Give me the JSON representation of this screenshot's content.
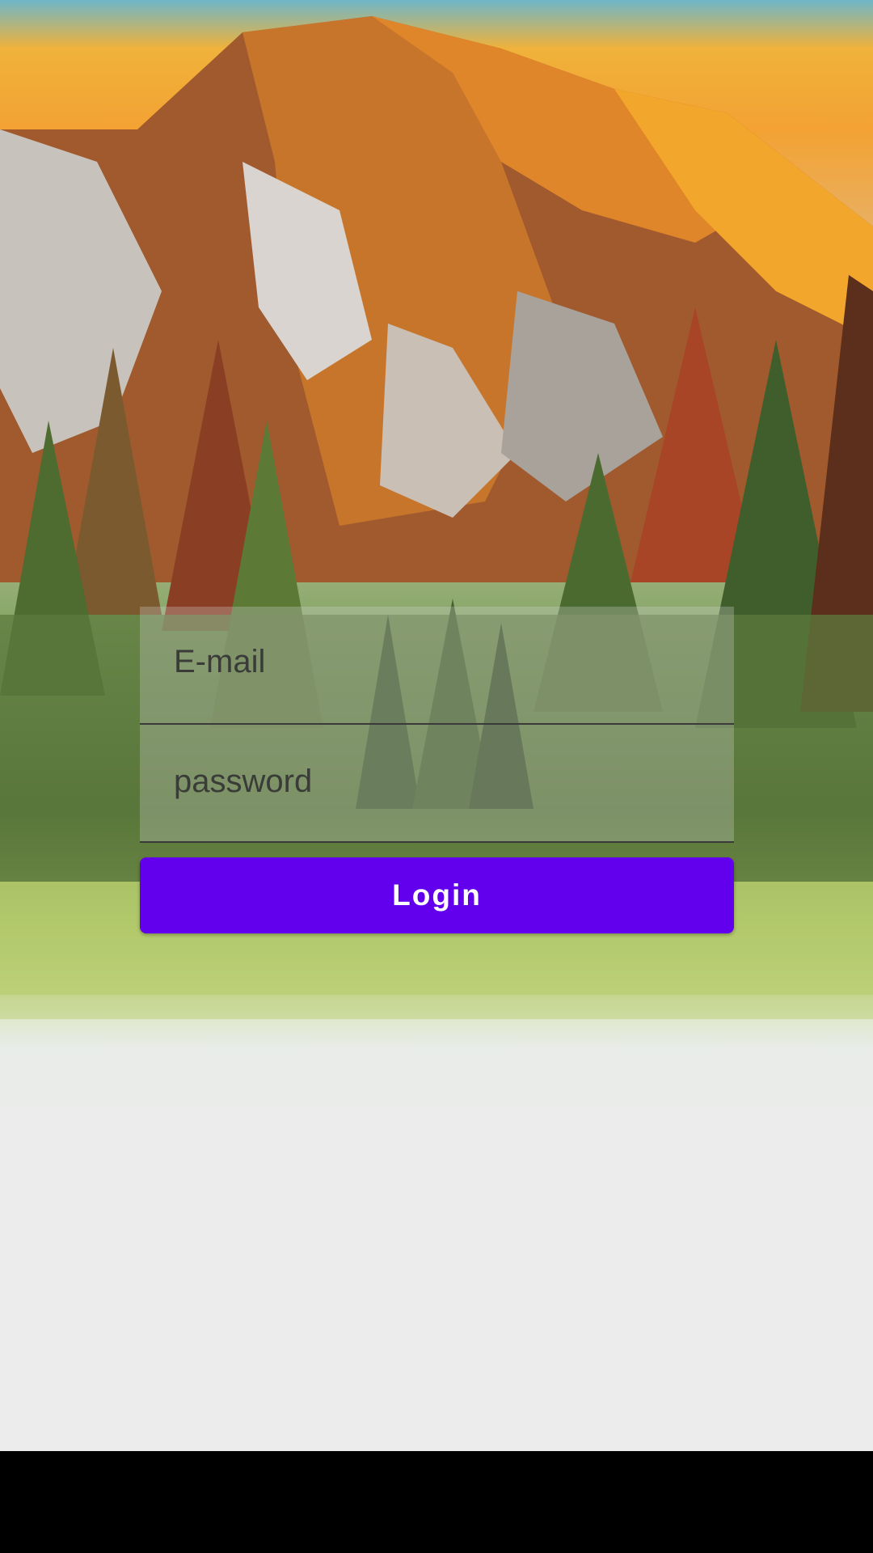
{
  "login_form": {
    "email_placeholder": "E-mail",
    "password_placeholder": "password",
    "login_label": "Login"
  },
  "colors": {
    "primary_button": "#6200ee",
    "button_text": "#ffffff"
  }
}
